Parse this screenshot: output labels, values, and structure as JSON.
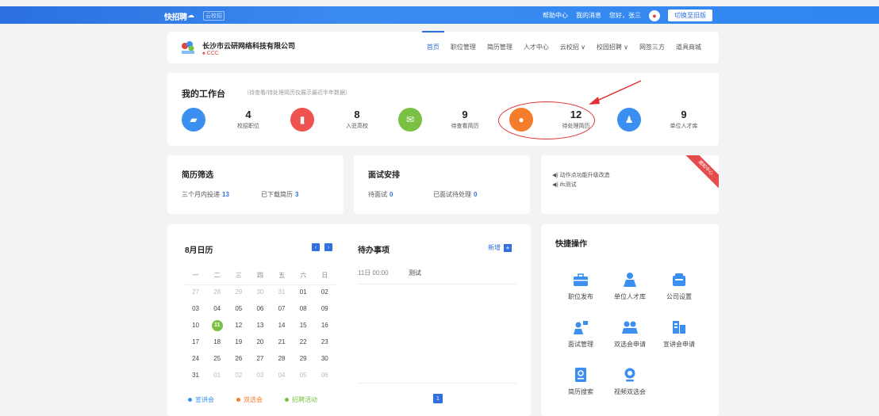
{
  "topbar": {
    "logo_text": "快招聘",
    "logo_sub": "云校招",
    "links": [
      "帮助中心",
      "我的消息",
      "您好，张三"
    ],
    "switch_label": "切换至旧版"
  },
  "company": {
    "name": "长沙市云研网络科技有限公司",
    "sub": "CCC",
    "nav": [
      "首页",
      "职位管理",
      "简历管理",
      "人才中心",
      "云校招 ∨",
      "校园招聘 ∨",
      "网签三方",
      "道具商城"
    ]
  },
  "workbench": {
    "title": "我的工作台",
    "note": "（待查看/待处理简历仅展示最近半年数据）",
    "stats": [
      {
        "value": "4",
        "label": "校招职位",
        "color": "#3b8ff0"
      },
      {
        "value": "8",
        "label": "入驻高校",
        "color": "#ef5350"
      },
      {
        "value": "9",
        "label": "待查看简历",
        "color": "#7ac143"
      },
      {
        "value": "12",
        "label": "待处理简历",
        "color": "#f57c2b"
      },
      {
        "value": "9",
        "label": "单位人才库",
        "color": "#3b8ff0"
      }
    ]
  },
  "resume": {
    "title": "简历筛选",
    "items": [
      {
        "label": "三个月内投递",
        "value": "13"
      },
      {
        "label": "已下载简历",
        "value": "3"
      }
    ]
  },
  "interview": {
    "title": "面试安排",
    "items": [
      {
        "label": "待面试",
        "value": "0"
      },
      {
        "label": "已面试待处理",
        "value": "0"
      }
    ]
  },
  "notice": {
    "lines": [
      "◀) 动作点功能升级改造",
      "◀) ifs测试"
    ],
    "ribbon": "通知中心"
  },
  "calendar": {
    "title": "8月日历",
    "weekdays": [
      "一",
      "二",
      "三",
      "四",
      "五",
      "六",
      "日"
    ],
    "weeks": [
      [
        "27",
        "28",
        "29",
        "30",
        "31",
        "01",
        "02"
      ],
      [
        "03",
        "04",
        "05",
        "06",
        "07",
        "08",
        "09"
      ],
      [
        "10",
        "11",
        "12",
        "13",
        "14",
        "15",
        "16"
      ],
      [
        "17",
        "18",
        "19",
        "20",
        "21",
        "22",
        "23"
      ],
      [
        "24",
        "25",
        "26",
        "27",
        "28",
        "29",
        "30"
      ],
      [
        "31",
        "01",
        "02",
        "03",
        "04",
        "05",
        "06"
      ]
    ],
    "today": "11",
    "legend": [
      {
        "label": "宣讲会",
        "color": "#3b8ff0"
      },
      {
        "label": "双选会",
        "color": "#f57c2b"
      },
      {
        "label": "招聘活动",
        "color": "#7ac143"
      }
    ]
  },
  "todo": {
    "title": "待办事项",
    "add_label": "新增",
    "items": [
      {
        "time": "11日 00:00",
        "content": "测试"
      }
    ],
    "page": "1"
  },
  "quick": {
    "title": "快捷操作",
    "items": [
      {
        "label": "职位发布",
        "icon": "briefcase-icon"
      },
      {
        "label": "单位人才库",
        "icon": "person-icon"
      },
      {
        "label": "公司设置",
        "icon": "case-icon"
      },
      {
        "label": "面试管理",
        "icon": "interview-icon"
      },
      {
        "label": "双选会申请",
        "icon": "group-icon"
      },
      {
        "label": "宣讲会申请",
        "icon": "building-icon"
      },
      {
        "label": "简历搜索",
        "icon": "resume-search-icon"
      },
      {
        "label": "视频双选会",
        "icon": "camera-icon"
      }
    ]
  },
  "colors": {
    "primary": "#2f6fe0",
    "annotation": "#e03030"
  }
}
